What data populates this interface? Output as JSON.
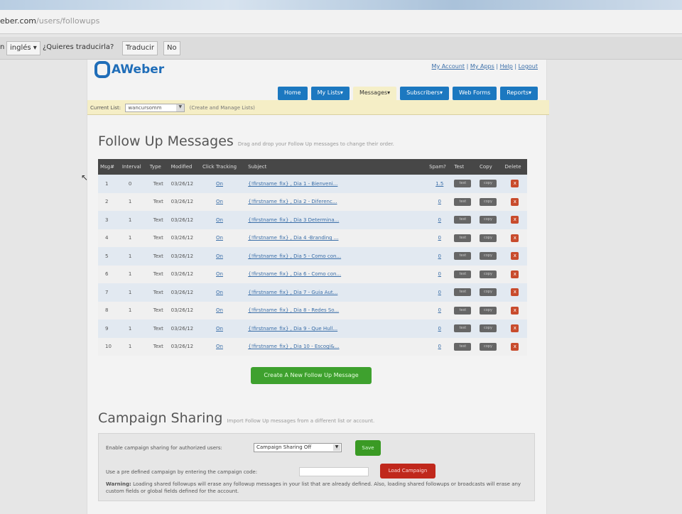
{
  "browser": {
    "url_host": "eber.com",
    "url_path": "/users/followups",
    "translate": {
      "language": "inglés",
      "question": "¿Quieres traducirla?",
      "translate_button": "Traducir",
      "no_button": "No"
    }
  },
  "header": {
    "logo": "AWeber",
    "links": [
      "My Account",
      "My Apps",
      "Help",
      "Logout"
    ],
    "nav": [
      "Home",
      "My Lists▾",
      "Messages▾",
      "Subscribers▾",
      "Web Forms",
      "Reports▾"
    ],
    "current_list_label": "Current List:",
    "current_list": "wancursomm",
    "manage_link": "(Create and Manage Lists)"
  },
  "followups": {
    "title": "Follow Up Messages",
    "subtitle": "Drag and drop your Follow Up messages to change their order.",
    "columns": [
      "Msg#",
      "Interval",
      "Type",
      "Modified",
      "Click Tracking",
      "Subject",
      "Spam?",
      "Test",
      "Copy",
      "Delete"
    ],
    "rows": [
      {
        "n": "1",
        "interval": "0",
        "type": "Text",
        "modified": "03/26/12",
        "tracking": "On",
        "subject": "{!firstname_fix} , Dia 1 - Bienveni...",
        "spam": "1.5"
      },
      {
        "n": "2",
        "interval": "1",
        "type": "Text",
        "modified": "03/26/12",
        "tracking": "On",
        "subject": "{!firstname_fix} , Dia 2 - Diferenc...",
        "spam": "0"
      },
      {
        "n": "3",
        "interval": "1",
        "type": "Text",
        "modified": "03/26/12",
        "tracking": "On",
        "subject": "{!firstname_fix} , Dia 3 Determina...",
        "spam": "0"
      },
      {
        "n": "4",
        "interval": "1",
        "type": "Text",
        "modified": "03/26/12",
        "tracking": "On",
        "subject": "{!firstname_fix} , Dia 4 -Branding ...",
        "spam": "0"
      },
      {
        "n": "5",
        "interval": "1",
        "type": "Text",
        "modified": "03/26/12",
        "tracking": "On",
        "subject": "{!firstname_fix} , Dia 5 - Como con...",
        "spam": "0"
      },
      {
        "n": "6",
        "interval": "1",
        "type": "Text",
        "modified": "03/26/12",
        "tracking": "On",
        "subject": "{!firstname_fix} , Dia 6 - Como con...",
        "spam": "0"
      },
      {
        "n": "7",
        "interval": "1",
        "type": "Text",
        "modified": "03/26/12",
        "tracking": "On",
        "subject": "{!firstname_fix} , Dia 7 - Guia Aut...",
        "spam": "0"
      },
      {
        "n": "8",
        "interval": "1",
        "type": "Text",
        "modified": "03/26/12",
        "tracking": "On",
        "subject": "{!firstname_fix} , Dia 8 - Redes So...",
        "spam": "0"
      },
      {
        "n": "9",
        "interval": "1",
        "type": "Text",
        "modified": "03/26/12",
        "tracking": "On",
        "subject": "{!firstname_fix} , Dia 9 - Que Hull...",
        "spam": "0"
      },
      {
        "n": "10",
        "interval": "1",
        "type": "Text",
        "modified": "03/26/12",
        "tracking": "On",
        "subject": "{!firstname_fix} , Dia 10 - Escogi&...",
        "spam": "0"
      }
    ],
    "test_label": "test",
    "copy_label": "copy",
    "delete_label": "x",
    "create_button": "Create A New Follow Up Message"
  },
  "sharing": {
    "title": "Campaign Sharing",
    "subtitle": "Import Follow Up messages from a different list or account.",
    "enable_label": "Enable campaign sharing for authorized users:",
    "enable_value": "Campaign Sharing Off",
    "save": "Save",
    "code_label": "Use a pre defined campaign by entering the campaign code:",
    "load": "Load Campaign",
    "warning_label": "Warning:",
    "warning": "Loading shared followups will erase any followup messages in your list that are already defined. Also, loading shared followups or broadcasts will erase any custom fields or global fields defined for the account."
  }
}
